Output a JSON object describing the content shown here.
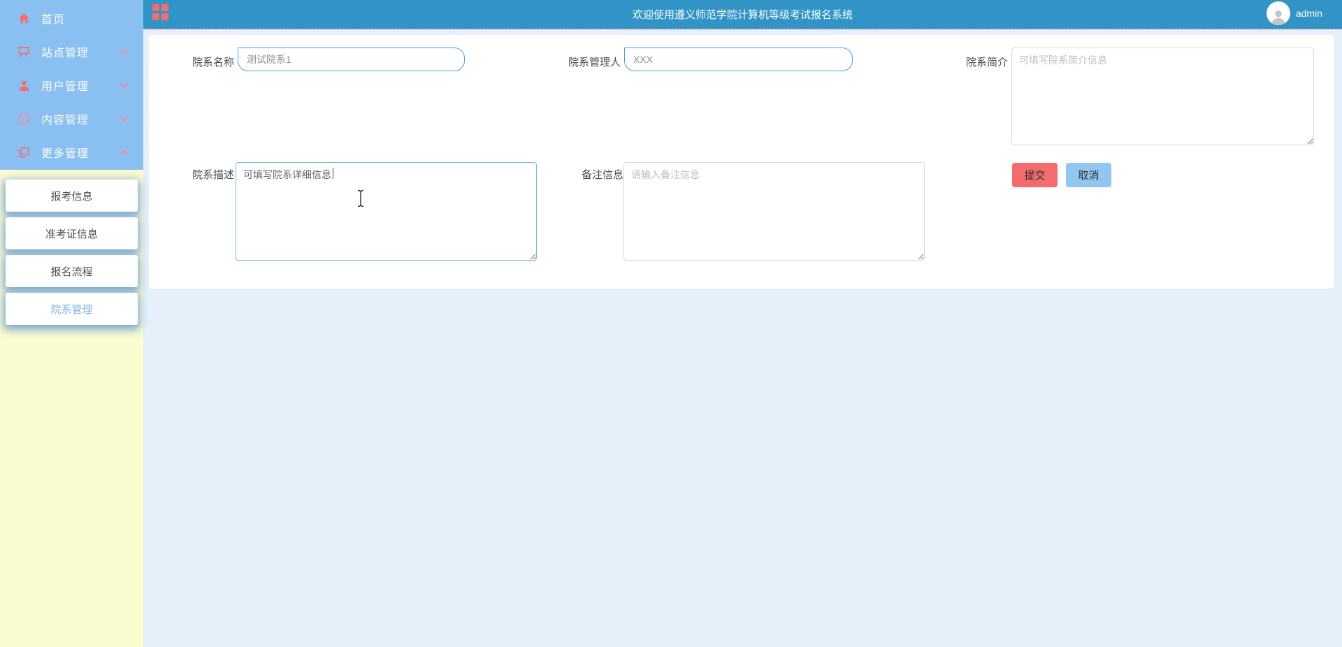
{
  "header": {
    "title": "欢迎使用遵义师范学院计算机等级考试报名系统",
    "user_name": "admin"
  },
  "sidebar": {
    "menu": [
      {
        "label": "首页",
        "icon": "home-icon",
        "expanded": null
      },
      {
        "label": "站点管理",
        "icon": "site-icon",
        "expanded": false
      },
      {
        "label": "用户管理",
        "icon": "user-icon",
        "expanded": false
      },
      {
        "label": "内容管理",
        "icon": "content-icon",
        "expanded": false
      },
      {
        "label": "更多管理",
        "icon": "more-icon",
        "expanded": true
      }
    ],
    "submenu": [
      {
        "label": "报考信息",
        "active": false
      },
      {
        "label": "准考证信息",
        "active": false
      },
      {
        "label": "报名流程",
        "active": false
      },
      {
        "label": "院系管理",
        "active": true
      }
    ]
  },
  "form": {
    "dept_name": {
      "label": "院系名称",
      "value": "测试院系1"
    },
    "dept_manager": {
      "label": "院系管理人",
      "value": "XXX"
    },
    "dept_intro": {
      "label": "院系简介",
      "placeholder": "可填写院系简介信息",
      "value": ""
    },
    "dept_desc": {
      "label": "院系描述",
      "value": "可填写院系详细信息"
    },
    "remark": {
      "label": "备注信息",
      "placeholder": "请输入备注信息",
      "value": ""
    },
    "buttons": {
      "submit": "提交",
      "cancel": "取消"
    }
  },
  "colors": {
    "header_bg": "#3294C6",
    "sidebar_menu_bg": "#8ABFF1",
    "sidebar_bg": "#FBFBD0",
    "icon_red": "#F56C6C",
    "chevron_pink": "#F28CA0",
    "submit_bg": "#F56C6C",
    "cancel_bg": "#90C6F0",
    "input_border_blue": "#46A0DC",
    "focused_border": "#6FB6E8",
    "content_bg": "#E6F0FB",
    "active_submenu_text": "#7FB2E2"
  }
}
